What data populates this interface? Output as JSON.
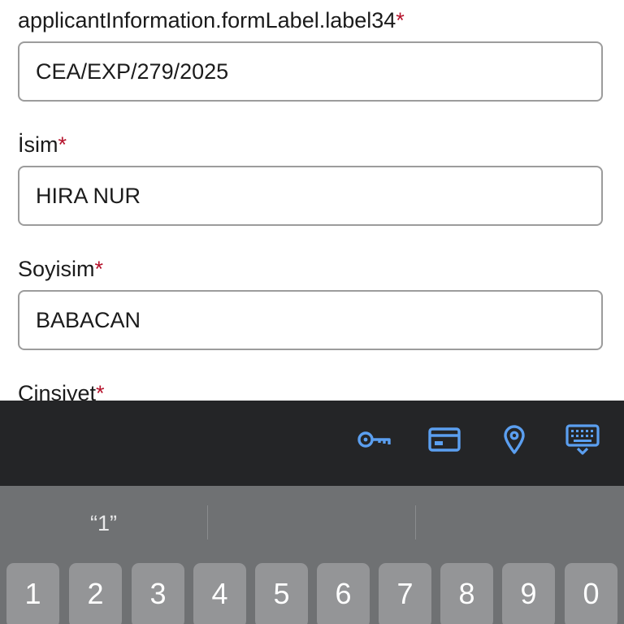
{
  "form": {
    "fields": [
      {
        "label": "applicantInformation.formLabel.label34",
        "required_mark": "*",
        "value": "CEA/EXP/279/2025"
      },
      {
        "label": "İsim",
        "required_mark": "*",
        "value": "HIRA NUR"
      },
      {
        "label": "Soyisim",
        "required_mark": "*",
        "value": "BABACAN"
      },
      {
        "label": "Cinsiyet",
        "required_mark": "*"
      }
    ]
  },
  "autofill_bar": {
    "icons": [
      "key-icon",
      "credit-card-icon",
      "location-pin-icon",
      "keyboard-icon"
    ],
    "icon_color": "#5b9ff0"
  },
  "keyboard": {
    "suggestions": [
      "“1”",
      "",
      ""
    ],
    "number_keys": [
      "1",
      "2",
      "3",
      "4",
      "5",
      "6",
      "7",
      "8",
      "9",
      "0"
    ]
  },
  "colors": {
    "required": "#b5122b",
    "autofill_bar_bg": "#242527",
    "keyboard_bg": "#6f7173",
    "key_bg": "#949597"
  }
}
